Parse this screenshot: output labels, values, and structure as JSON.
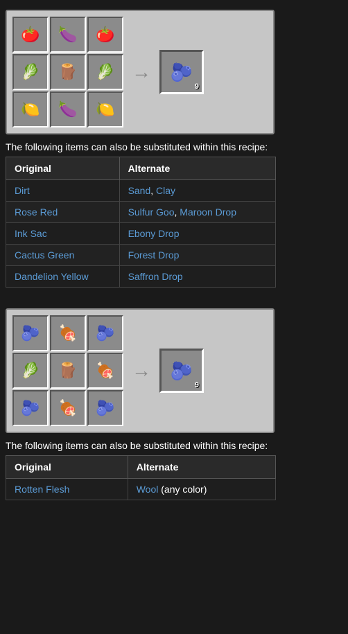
{
  "recipe1": {
    "grid": [
      "🍅",
      "🍆",
      "🍅",
      "🥬",
      "🪵",
      "🥬",
      "🍋",
      "🍆",
      "🍋"
    ],
    "result_emoji": "🫐",
    "result_count": "9",
    "arrow": "→"
  },
  "substitution_text_1": "The following items can also be substituted within this recipe:",
  "table1": {
    "headers": [
      "Original",
      "Alternate"
    ],
    "rows": [
      {
        "original": "Dirt",
        "alternates": [
          {
            "text": "Sand",
            "link": true
          },
          {
            "text": ", "
          },
          {
            "text": "Clay",
            "link": true
          }
        ]
      },
      {
        "original": "Rose Red",
        "alternates": [
          {
            "text": "Sulfur Goo",
            "link": true
          },
          {
            "text": ", "
          },
          {
            "text": "Maroon Drop",
            "link": true
          }
        ]
      },
      {
        "original": "Ink Sac",
        "alternates": [
          {
            "text": "Ebony Drop",
            "link": true
          }
        ]
      },
      {
        "original": "Cactus Green",
        "alternates": [
          {
            "text": "Forest Drop",
            "link": true
          }
        ]
      },
      {
        "original": "Dandelion Yellow",
        "alternates": [
          {
            "text": "Saffron Drop",
            "link": true
          }
        ]
      }
    ]
  },
  "recipe2": {
    "grid": [
      "🫐",
      "🍖",
      "🫐",
      "🥬",
      "🪵",
      "🍖",
      "🫐",
      "🍖",
      "🫐"
    ],
    "result_emoji": "🫐",
    "result_count": "9",
    "arrow": "→"
  },
  "substitution_text_2": "The following items can also be substituted within this recipe:",
  "table2": {
    "headers": [
      "Original",
      "Alternate"
    ],
    "rows": [
      {
        "original": "Rotten Flesh",
        "alternates": [
          {
            "text": "Wool",
            "link": true
          },
          {
            "text": " (any color)",
            "link": false
          }
        ]
      }
    ]
  }
}
